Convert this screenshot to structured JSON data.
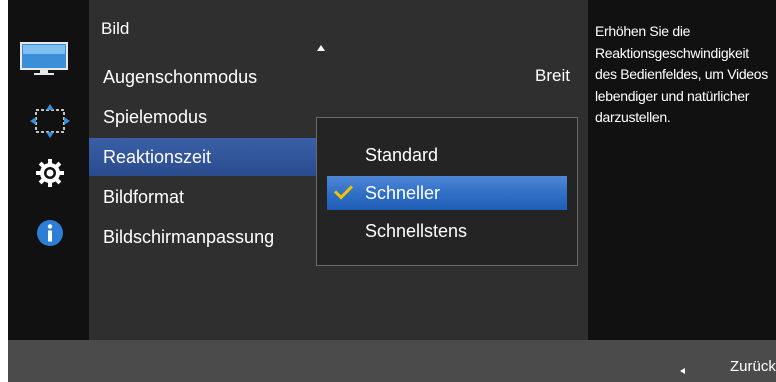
{
  "menu": {
    "title": "Bild",
    "items": [
      {
        "label": "Augenschonmodus"
      },
      {
        "label": "Spielemodus"
      },
      {
        "label": "Reaktionszeit"
      },
      {
        "label": "Bildformat"
      },
      {
        "label": "Bildschirmanpassung"
      }
    ],
    "first_item_value": "Breit",
    "selected_item": "Reaktionszeit"
  },
  "submenu": {
    "options": [
      {
        "label": "Standard"
      },
      {
        "label": "Schneller"
      },
      {
        "label": "Schnellstens"
      }
    ],
    "selected_option": "Schneller"
  },
  "description": "Erhöhen Sie die Reaktionsgeschwindigkeit des Bedienfeldes, um Videos lebendiger und natürlicher darzustellen.",
  "footer": {
    "back_label": "Zurück"
  },
  "side_icons": [
    "picture-icon",
    "screen-size-icon",
    "gear-icon",
    "info-icon"
  ],
  "colors": {
    "selection_blue": "#2e6ec4",
    "menu_highlight": "#2b4b8e",
    "check_yellow": "#f2c200",
    "panel_bg": "#2f2f2f",
    "footer_bg": "#4b4b4b"
  }
}
